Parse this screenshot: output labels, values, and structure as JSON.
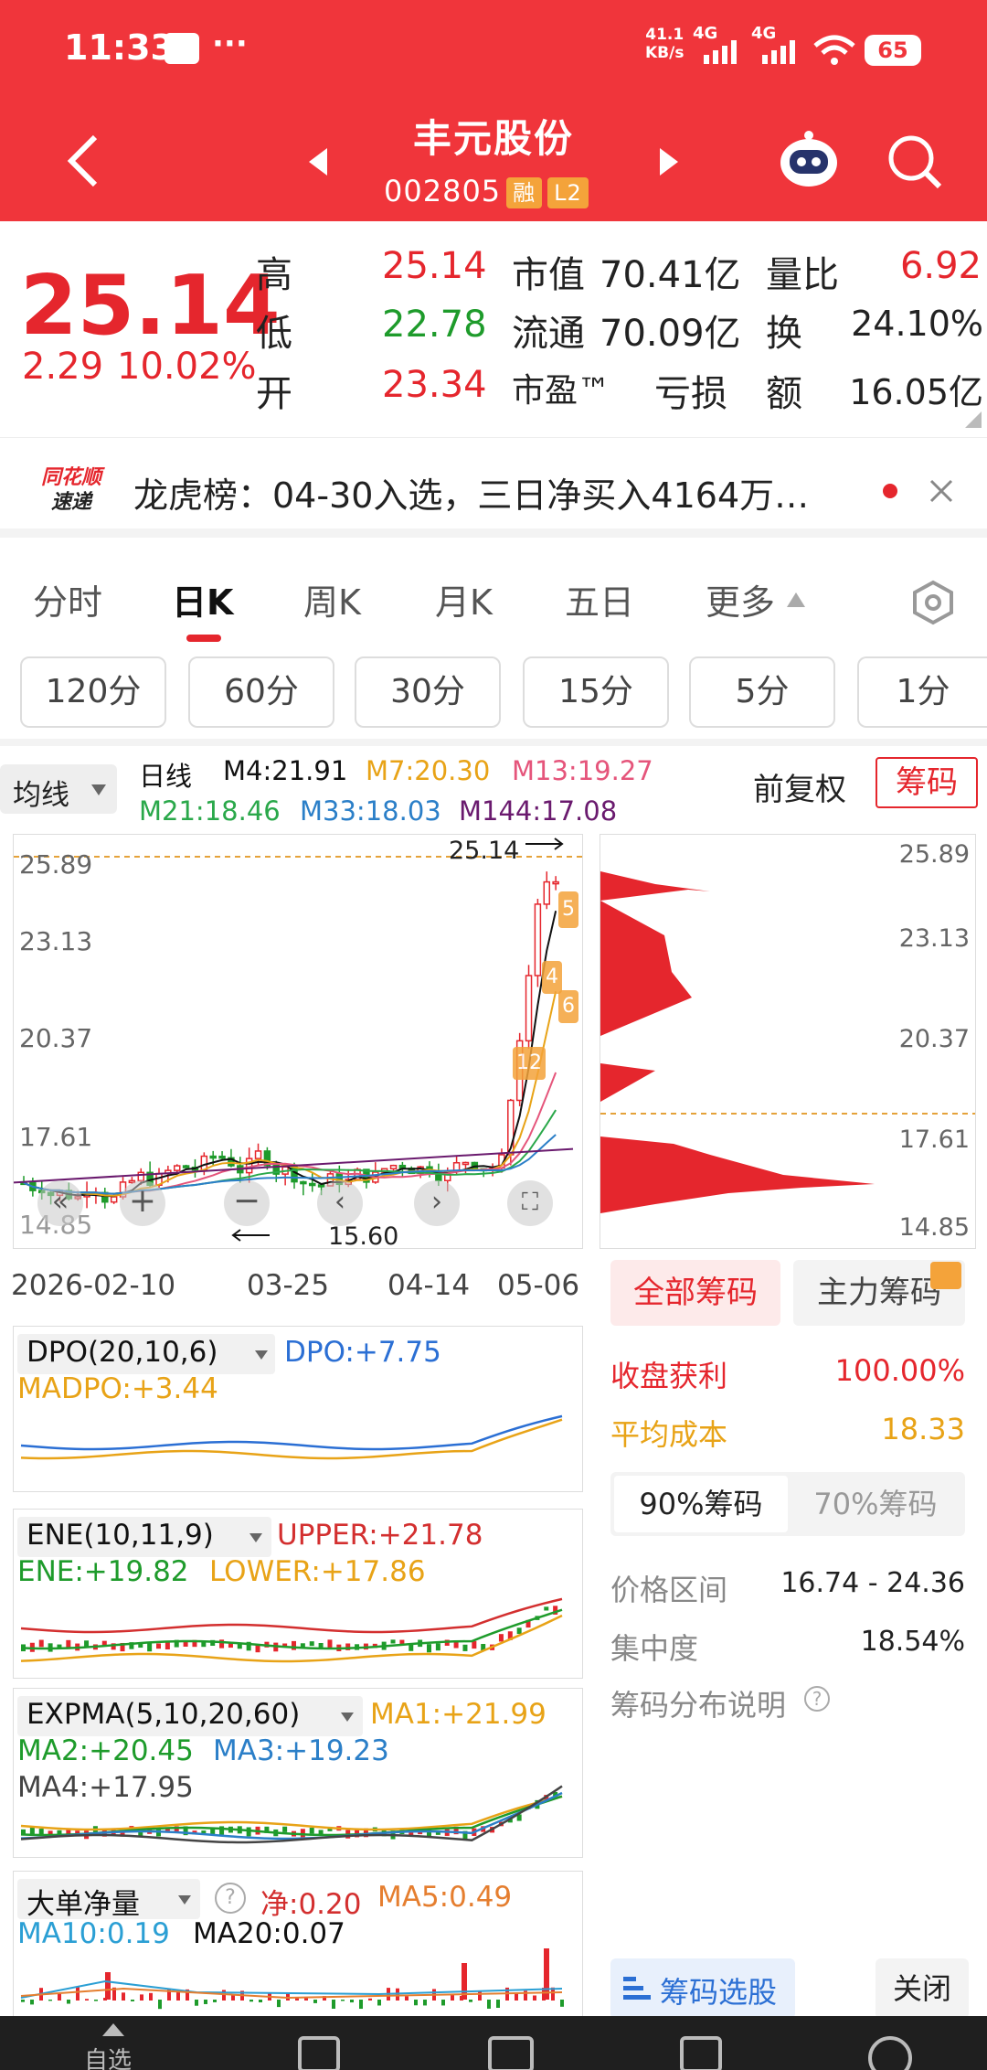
{
  "status": {
    "time": "11:33",
    "speed_top": "41.1",
    "speed_bottom": "KB/s",
    "net1": "4G",
    "net2": "4G",
    "battery": "65"
  },
  "header": {
    "title": "丰元股份",
    "code": "002805",
    "tag1": "融",
    "tag2": "L2"
  },
  "quote": {
    "price": "25.14",
    "change": "2.29",
    "pct": "10.02%",
    "high_label": "高",
    "high": "25.14",
    "low_label": "低",
    "low": "22.78",
    "open_label": "开",
    "open": "23.34",
    "mcap_label": "市值",
    "mcap": "70.41亿",
    "float_label": "流通",
    "float": "70.09亿",
    "pe_label": "市盈™",
    "pe": "亏损",
    "vr_label": "量比",
    "vr": "6.92",
    "turn_label": "换",
    "turn": "24.10%",
    "amt_label": "额",
    "amt": "16.05亿"
  },
  "news": {
    "logo_top": "同花顺",
    "logo_bottom": "速递",
    "text": "龙虎榜：04-30入选，三日净买入4164万…"
  },
  "tabs": [
    "分时",
    "日K",
    "周K",
    "月K",
    "五日",
    "更多"
  ],
  "periods": [
    "120分",
    "60分",
    "30分",
    "15分",
    "5分",
    "1分"
  ],
  "ma": {
    "selector": "均线",
    "period": "日线",
    "m4": "M4:21.91",
    "m7": "M7:20.30",
    "m13": "M13:19.27",
    "m21": "M21:18.46",
    "m33": "M33:18.03",
    "m144": "M144:17.08",
    "adjust": "前复权",
    "chips_btn": "筹码"
  },
  "kchart": {
    "y_labels": [
      "25.89",
      "23.13",
      "20.37",
      "17.61",
      "14.85"
    ],
    "max_label": "25.14",
    "min_label": "15.60",
    "dates": [
      "2026-02-10",
      "03-25",
      "04-14",
      "05-06"
    ],
    "badges": [
      "5",
      "4",
      "6",
      "12"
    ]
  },
  "chips": {
    "y_labels": [
      "25.89",
      "23.13",
      "20.37",
      "17.61",
      "14.85"
    ],
    "tab_all": "全部筹码",
    "tab_main": "主力筹码",
    "profit_label": "收盘获利",
    "profit": "100.00%",
    "cost_label": "平均成本",
    "cost": "18.33",
    "opt90": "90%筹码",
    "opt70": "70%筹码",
    "range_label": "价格区间",
    "range": "16.74 - 24.36",
    "conc_label": "集中度",
    "conc": "18.54%",
    "explain": "筹码分布说明",
    "select_btn": "筹码选股",
    "close_btn": "关闭"
  },
  "indicators": {
    "dpo": {
      "name": "DPO(20,10,6)",
      "v1": "DPO:+7.75",
      "v2": "MADPO:+3.44"
    },
    "ene": {
      "name": "ENE(10,11,9)",
      "v1": "UPPER:+21.78",
      "v2": "ENE:+19.82",
      "v3": "LOWER:+17.86"
    },
    "expma": {
      "name": "EXPMA(5,10,20,60)",
      "v1": "MA1:+21.99",
      "v2": "MA2:+20.45",
      "v3": "MA3:+19.23",
      "v4": "MA4:+17.95"
    },
    "big": {
      "name": "大单净量",
      "v1": "净:0.20",
      "v2": "MA5:0.49",
      "v3": "MA10:0.19",
      "v4": "MA20:0.07"
    }
  },
  "bottom_label": "自选",
  "colors": {
    "brand": "#f0353b",
    "up": "#e5262d",
    "down": "#1e9b2b",
    "badge": "#f4a33a"
  }
}
